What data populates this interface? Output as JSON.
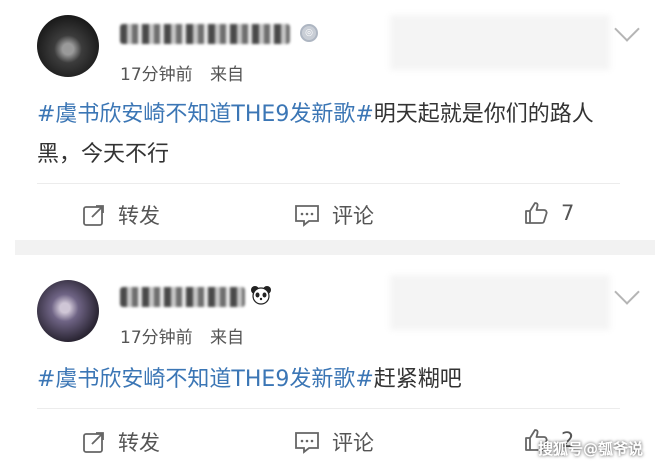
{
  "posts": [
    {
      "time": "17分钟前",
      "source": "来自",
      "topic": "#虞书欣安崎不知道THE9发新歌#",
      "text": "明天起就是你们的路人黑，今天不行",
      "repost_label": "转发",
      "comment_label": "评论",
      "like_count": "7"
    },
    {
      "time": "17分钟前",
      "source": "来自",
      "topic": "#虞书欣安崎不知道THE9发新歌#",
      "text": "赶紧糊吧",
      "repost_label": "转发",
      "comment_label": "评论",
      "like_count": "2"
    }
  ],
  "watermark": "搜狐号@瓠爷说",
  "colors": {
    "topic": "#3b76b5",
    "text": "#333333",
    "meta": "#555555",
    "divider": "#f2f2f2"
  }
}
